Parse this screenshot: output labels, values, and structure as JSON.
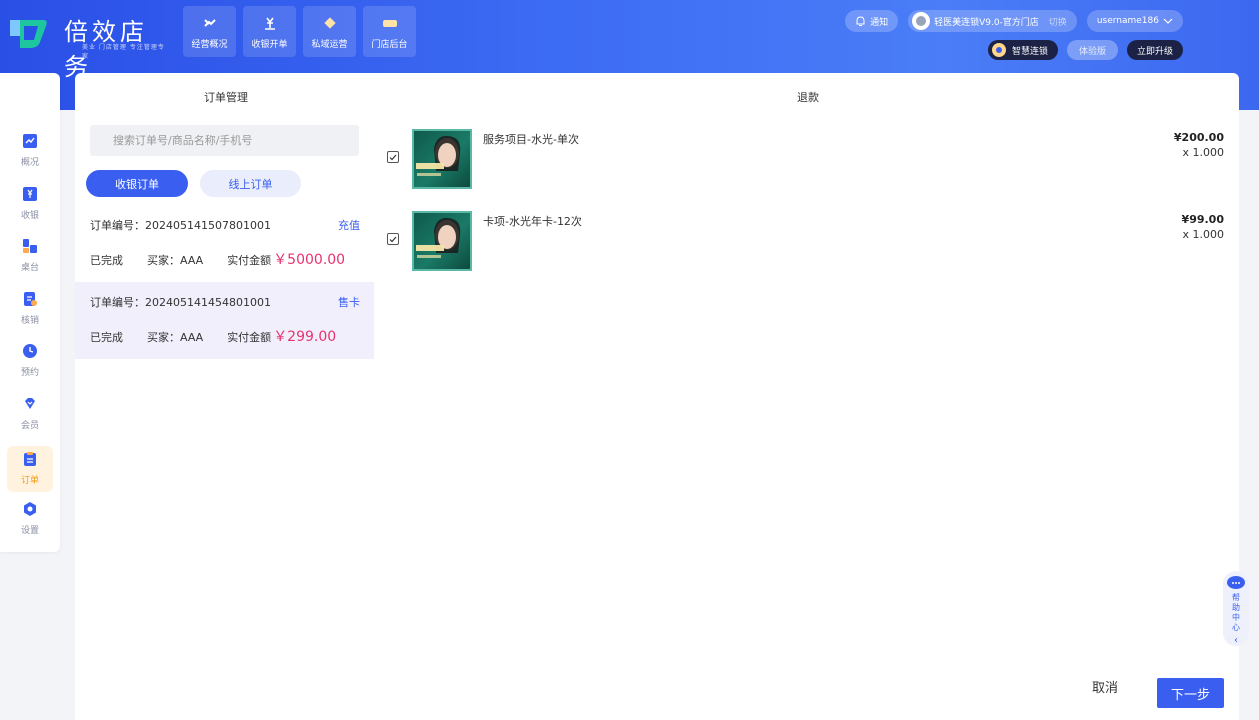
{
  "app": {
    "title": "倍效店务",
    "subtitle": "美业 门店管理 专注管理专家"
  },
  "topnav": [
    {
      "label": "经营概况",
      "icon": "trend-icon"
    },
    {
      "label": "收银开单",
      "icon": "yen-icon"
    },
    {
      "label": "私域运营",
      "icon": "diamond-icon"
    },
    {
      "label": "门店后台",
      "icon": "store-icon"
    }
  ],
  "header": {
    "notify_label": "通知",
    "store_name": "轻医美连锁V9.0-官方门店",
    "switch_label": "切换",
    "username": "username186",
    "brand_badge": "智慧连锁",
    "trial_label": "体验版",
    "upgrade_label": "立即升级"
  },
  "sidebar": [
    {
      "label": "概况",
      "icon": "chart-icon"
    },
    {
      "label": "收银",
      "icon": "yen-icon"
    },
    {
      "label": "桌台",
      "icon": "table-icon"
    },
    {
      "label": "核销",
      "icon": "verify-icon"
    },
    {
      "label": "预约",
      "icon": "clock-icon"
    },
    {
      "label": "会员",
      "icon": "diamond-icon"
    },
    {
      "label": "订单",
      "icon": "clipboard-icon",
      "active": true
    },
    {
      "label": "设置",
      "icon": "settings-icon"
    }
  ],
  "orders_panel": {
    "title": "订单管理",
    "search_placeholder": "搜索订单号/商品名称/手机号",
    "tabs": [
      "收银订单",
      "线上订单"
    ],
    "orders": [
      {
        "no": "订单编号：202405141507801001",
        "type": "充值",
        "status": "已完成",
        "buyer": "买家：AAA",
        "amount_label": "实付金额",
        "amount": "￥5000.00"
      },
      {
        "no": "订单编号：202405141454801001",
        "type": "售卡",
        "status": "已完成",
        "buyer": "买家：AAA",
        "amount_label": "实付金额",
        "amount": "￥299.00",
        "selected": true
      }
    ]
  },
  "refund_panel": {
    "title": "退款",
    "items": [
      {
        "name": "服务项目-水光-单次",
        "price": "¥200.00",
        "qty": "x 1.000",
        "checked": true,
        "thumb_caption": "爱马仕水光"
      },
      {
        "name": "卡项-水光年卡-12次",
        "price": "¥99.00",
        "qty": "x 1.000",
        "checked": true,
        "thumb_caption": "爱马仕水光"
      }
    ],
    "cancel_label": "取消",
    "next_label": "下一步"
  },
  "help": {
    "label": "帮助中心"
  },
  "colors": {
    "primary": "#3a5ff0",
    "amount": "#e8326f",
    "active_side": "#f39c12"
  }
}
